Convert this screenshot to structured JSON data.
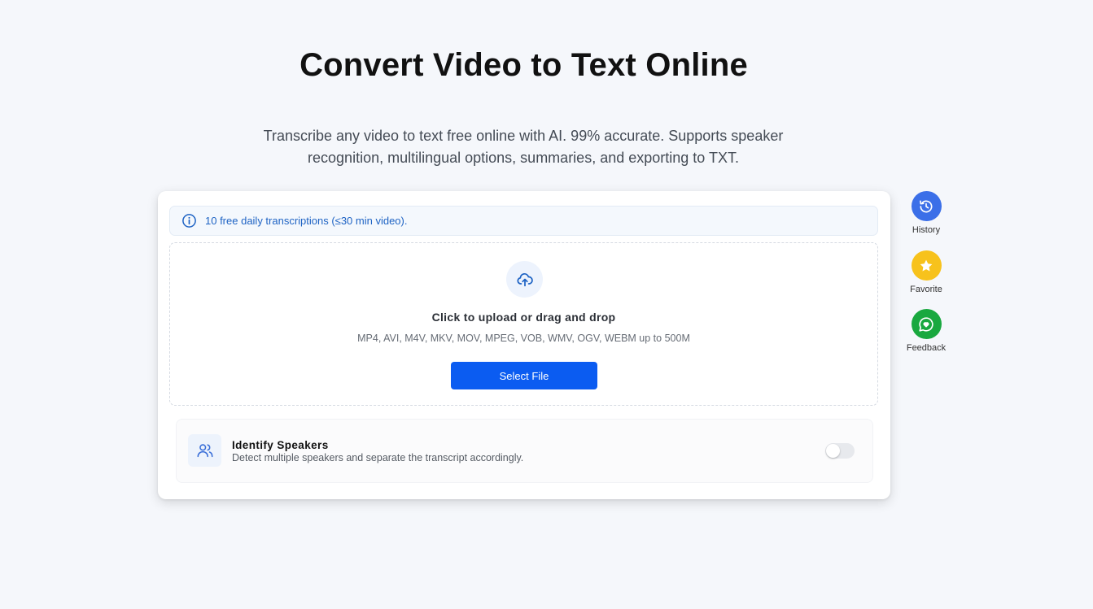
{
  "page": {
    "title": "Convert Video to Text Online",
    "subtitle": "Transcribe any video to text free online with AI. 99% accurate. Supports speaker recognition, multilingual options, summaries, and exporting to TXT."
  },
  "notice": {
    "icon": "info-icon",
    "text": "10 free daily transcriptions (≤30 min video)."
  },
  "upload": {
    "icon": "cloud-upload-icon",
    "title": "Click to upload or drag and drop",
    "formats": "MP4, AVI, M4V, MKV, MOV, MPEG, VOB, WMV, OGV, WEBM up to 500M",
    "button_label": "Select File"
  },
  "speakers": {
    "icon": "users-icon",
    "title": "Identify Speakers",
    "description": "Detect multiple speakers and separate the transcript accordingly.",
    "enabled": false
  },
  "side_actions": [
    {
      "label": "History",
      "icon": "history-icon",
      "color": "#3b6fe8"
    },
    {
      "label": "Favorite",
      "icon": "star-icon",
      "color": "#f7c21c"
    },
    {
      "label": "Feedback",
      "icon": "chat-heart-icon",
      "color": "#19a83f"
    }
  ],
  "colors": {
    "accent": "#0b5cf1",
    "background": "#f5f7fb",
    "notice_text": "#1e63c4"
  }
}
